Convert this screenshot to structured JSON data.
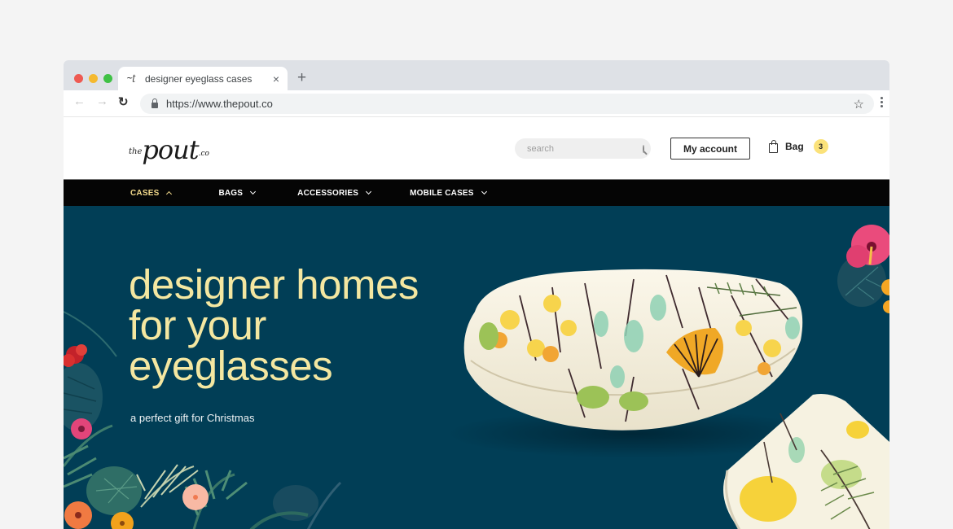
{
  "browser": {
    "tab": {
      "favicon": "thepout-logo-icon",
      "title": "designer eyeglass cases",
      "close_glyph": "×"
    },
    "new_tab_glyph": "+",
    "nav": {
      "back_glyph": "←",
      "forward_glyph": "→",
      "reload_glyph": "↻"
    },
    "url": "https://www.thepout.co",
    "star_glyph": "☆",
    "traffic_lights": {
      "close": "#ee5a52",
      "minimize": "#f5b92f",
      "maximize": "#3fc145"
    }
  },
  "site": {
    "logo": {
      "the": "the",
      "pout": "pout",
      "co": ".co"
    },
    "search": {
      "placeholder": "search",
      "value": ""
    },
    "account_label": "My account",
    "bag": {
      "label": "Bag",
      "count": "3"
    },
    "nav": [
      {
        "label": "CASES",
        "state": "expanded",
        "active": true
      },
      {
        "label": "BAGS",
        "state": "collapsed",
        "active": false
      },
      {
        "label": "ACCESSORIES",
        "state": "collapsed",
        "active": false
      },
      {
        "label": "MOBILE CASES",
        "state": "collapsed",
        "active": false
      }
    ],
    "colors": {
      "nav_bg": "#050505",
      "nav_active": "#f2d98b",
      "hero_bg": "#013e56",
      "hero_title": "#f4e7a1",
      "bag_badge": "#fbe27a"
    }
  },
  "hero": {
    "title_lines": [
      "designer homes",
      "for your",
      "eyeglasses"
    ],
    "subtitle": "a perfect gift for Christmas",
    "image_alt": "floral patterned eyeglass case with matching cleaning cloth"
  }
}
